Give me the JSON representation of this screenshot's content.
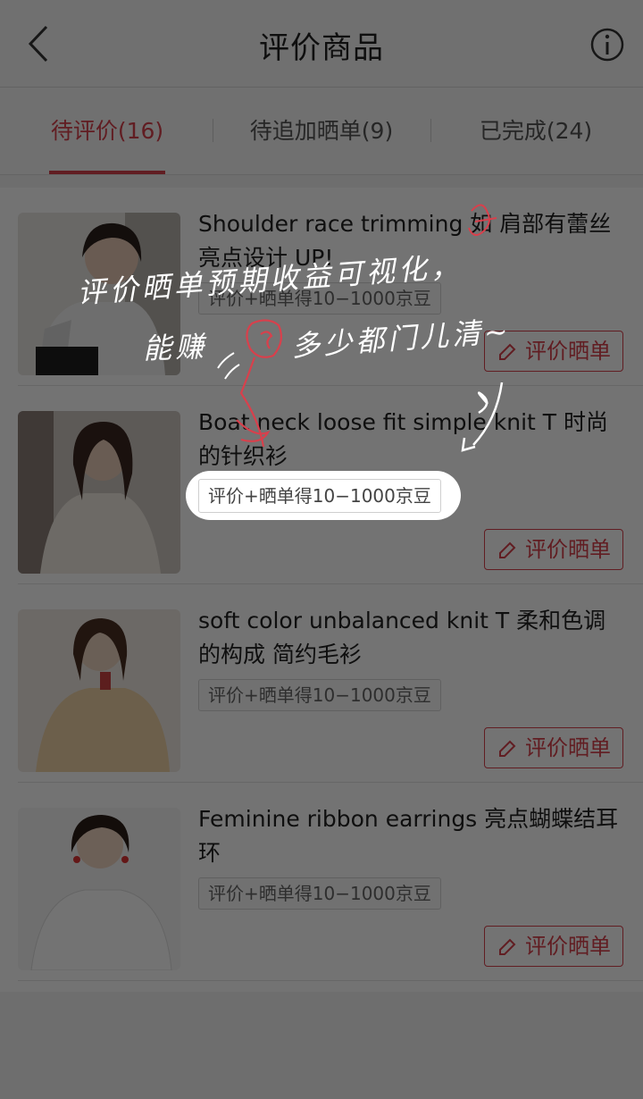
{
  "header": {
    "title": "评价商品"
  },
  "tabs": [
    {
      "label": "待评价(16)"
    },
    {
      "label": "待追加晒单(9)"
    },
    {
      "label": "已完成(24)"
    }
  ],
  "items": [
    {
      "name": "Shoulder race trimming 如 肩部有蕾丝亮点设计 UP!",
      "reward": "评价+晒单得10−1000京豆",
      "button": "评价晒单"
    },
    {
      "name": "Boat neck loose fit simple knit T 时尚的针织衫",
      "reward": "评价+晒单得10−1000京豆",
      "button": "评价晒单"
    },
    {
      "name": "soft color unbalanced knit T 柔和色调的构成 简约毛衫",
      "reward": "评价+晒单得10−1000京豆",
      "button": "评价晒单"
    },
    {
      "name": "Feminine ribbon earrings 亮点蝴蝶结耳环",
      "reward": "评价+晒单得10−1000京豆",
      "button": "评价晒单"
    }
  ],
  "annotation": {
    "line1": "评价晒单预期收益可视化，",
    "line2a": "能赚",
    "line2b": "多少都门儿清~"
  },
  "colors": {
    "accent": "#d8404c"
  },
  "icons": [
    "back-arrow-icon",
    "info-icon",
    "edit-pencil-icon",
    "money-bag-doodle-icon"
  ]
}
